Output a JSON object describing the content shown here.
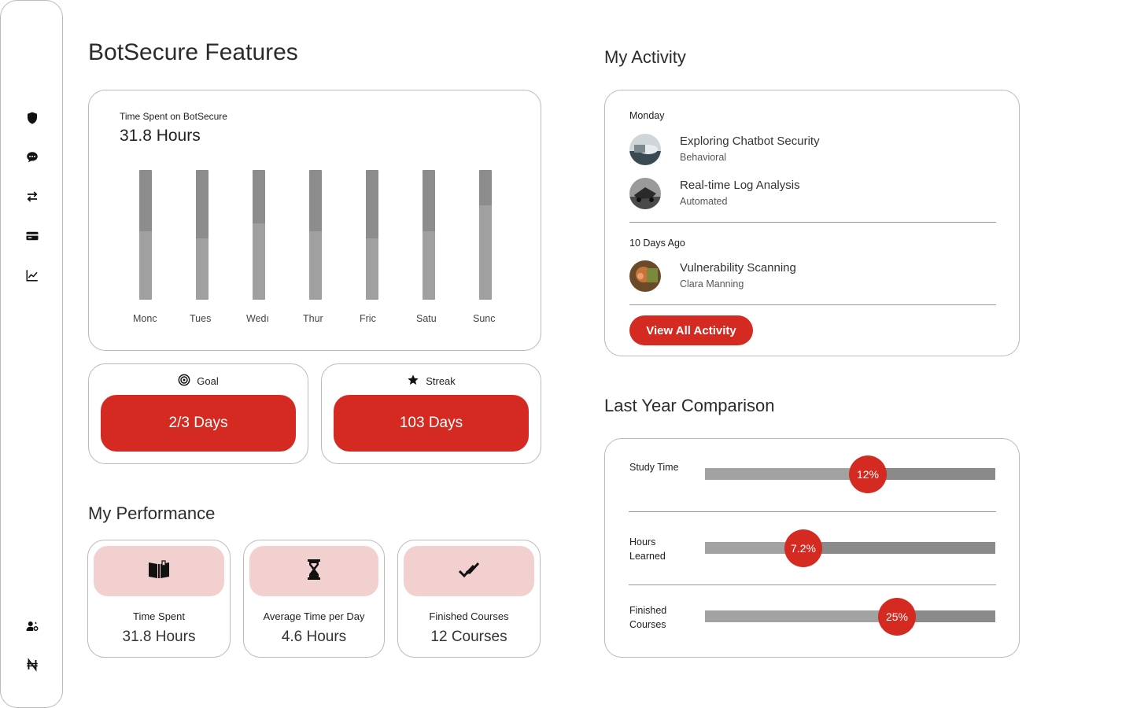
{
  "sidebar": {
    "icons": [
      "shield-icon",
      "chat-icon",
      "swap-icon",
      "card-icon",
      "chart-icon",
      "user-settings-icon",
      "currency-icon"
    ]
  },
  "features": {
    "title": "BotSecure Features",
    "chart_label": "Time Spent on BotSecure",
    "chart_value": "31.8 Hours"
  },
  "chart_data": {
    "type": "bar",
    "title": "",
    "categories": [
      "Monday",
      "Tuesday",
      "Wednesday",
      "Thursday",
      "Friday",
      "Saturday",
      "Sunday"
    ],
    "category_labels_visible": [
      "Monc",
      "Tues",
      "Wedı",
      "Thur",
      "Fric",
      "Satu",
      "Sunc"
    ],
    "series": [
      {
        "values": [
          0.53,
          0.47,
          0.59,
          0.53,
          0.47,
          0.53,
          0.73
        ]
      }
    ],
    "ylim": [
      0,
      1
    ],
    "grid": false
  },
  "goal": {
    "label": "Goal",
    "value": "2/3 Days"
  },
  "streak": {
    "label": "Streak",
    "value": "103 Days"
  },
  "performance": {
    "title": "My Performance",
    "items": [
      {
        "label": "Time Spent",
        "value": "31.8 Hours",
        "icon": "book-icon"
      },
      {
        "label": "Average Time per Day",
        "value": "4.6 Hours",
        "icon": "hourglass-icon"
      },
      {
        "label": "Finished Courses",
        "value": "12 Courses",
        "icon": "double-check-icon"
      }
    ]
  },
  "activity": {
    "title": "My Activity",
    "groups": [
      {
        "day": "Monday",
        "items": [
          {
            "title": "Exploring Chatbot Security",
            "subtitle": "Behavioral"
          },
          {
            "title": "Real-time Log Analysis",
            "subtitle": "Automated"
          }
        ]
      },
      {
        "day": "10 Days Ago",
        "items": [
          {
            "title": "Vulnerability Scanning",
            "subtitle": "Clara Manning"
          }
        ]
      }
    ],
    "button": "View All Activity"
  },
  "comparison": {
    "title": "Last Year Comparison",
    "rows": [
      {
        "label": "Study Time",
        "percent": "12%",
        "level": 0.56
      },
      {
        "label": "Hours Learned",
        "percent": "7.2%",
        "level": 0.34
      },
      {
        "label": "Finished Courses",
        "percent": "25%",
        "level": 0.66
      }
    ]
  },
  "colors": {
    "accent": "#d42a22",
    "pink": "#f2d0cf",
    "bar_dark": "#8c8c8c",
    "bar_light": "#a0a0a0"
  }
}
